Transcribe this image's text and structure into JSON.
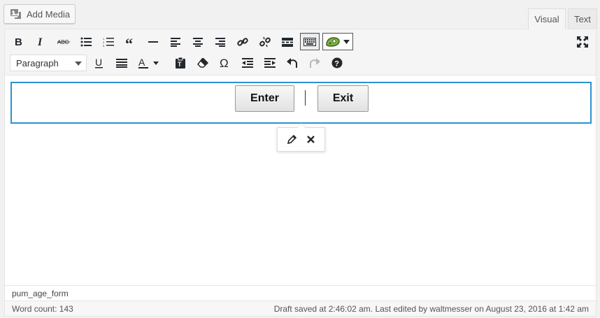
{
  "media": {
    "add_media_label": "Add Media"
  },
  "tabs": [
    {
      "label": "Visual"
    },
    {
      "label": "Text"
    }
  ],
  "toolbar": {
    "format_select_value": "Paragraph",
    "row1_icons": [
      "bold-icon",
      "italic-icon",
      "strikethrough-icon",
      "bulleted-list-icon",
      "numbered-list-icon",
      "blockquote-icon",
      "horizontal-line-icon",
      "align-left-icon",
      "align-center-icon",
      "align-right-icon",
      "insert-link-icon",
      "remove-link-icon",
      "read-more-icon",
      "toolbar-toggle-icon",
      "popup-maker-icon"
    ],
    "row2_icons": [
      "underline-icon",
      "justify-icon",
      "text-color-icon",
      "paste-as-text-icon",
      "clear-formatting-icon",
      "special-character-icon",
      "outdent-icon",
      "indent-icon",
      "undo-icon",
      "redo-icon",
      "help-icon"
    ]
  },
  "content": {
    "enter_label": "Enter",
    "exit_label": "Exit"
  },
  "popover": {
    "icons": [
      "edit-pencil-icon",
      "remove-x-icon"
    ]
  },
  "path_bar": {
    "text": "pum_age_form"
  },
  "status_bar": {
    "word_count": "Word count: 143",
    "draft_status": "Draft saved at 2:46:02 am. Last edited by waltmesser on August 23, 2016 at 1:42 am"
  },
  "colors": {
    "accent_border": "#2e8fcf",
    "popup_maker_green": "#7cb342"
  }
}
